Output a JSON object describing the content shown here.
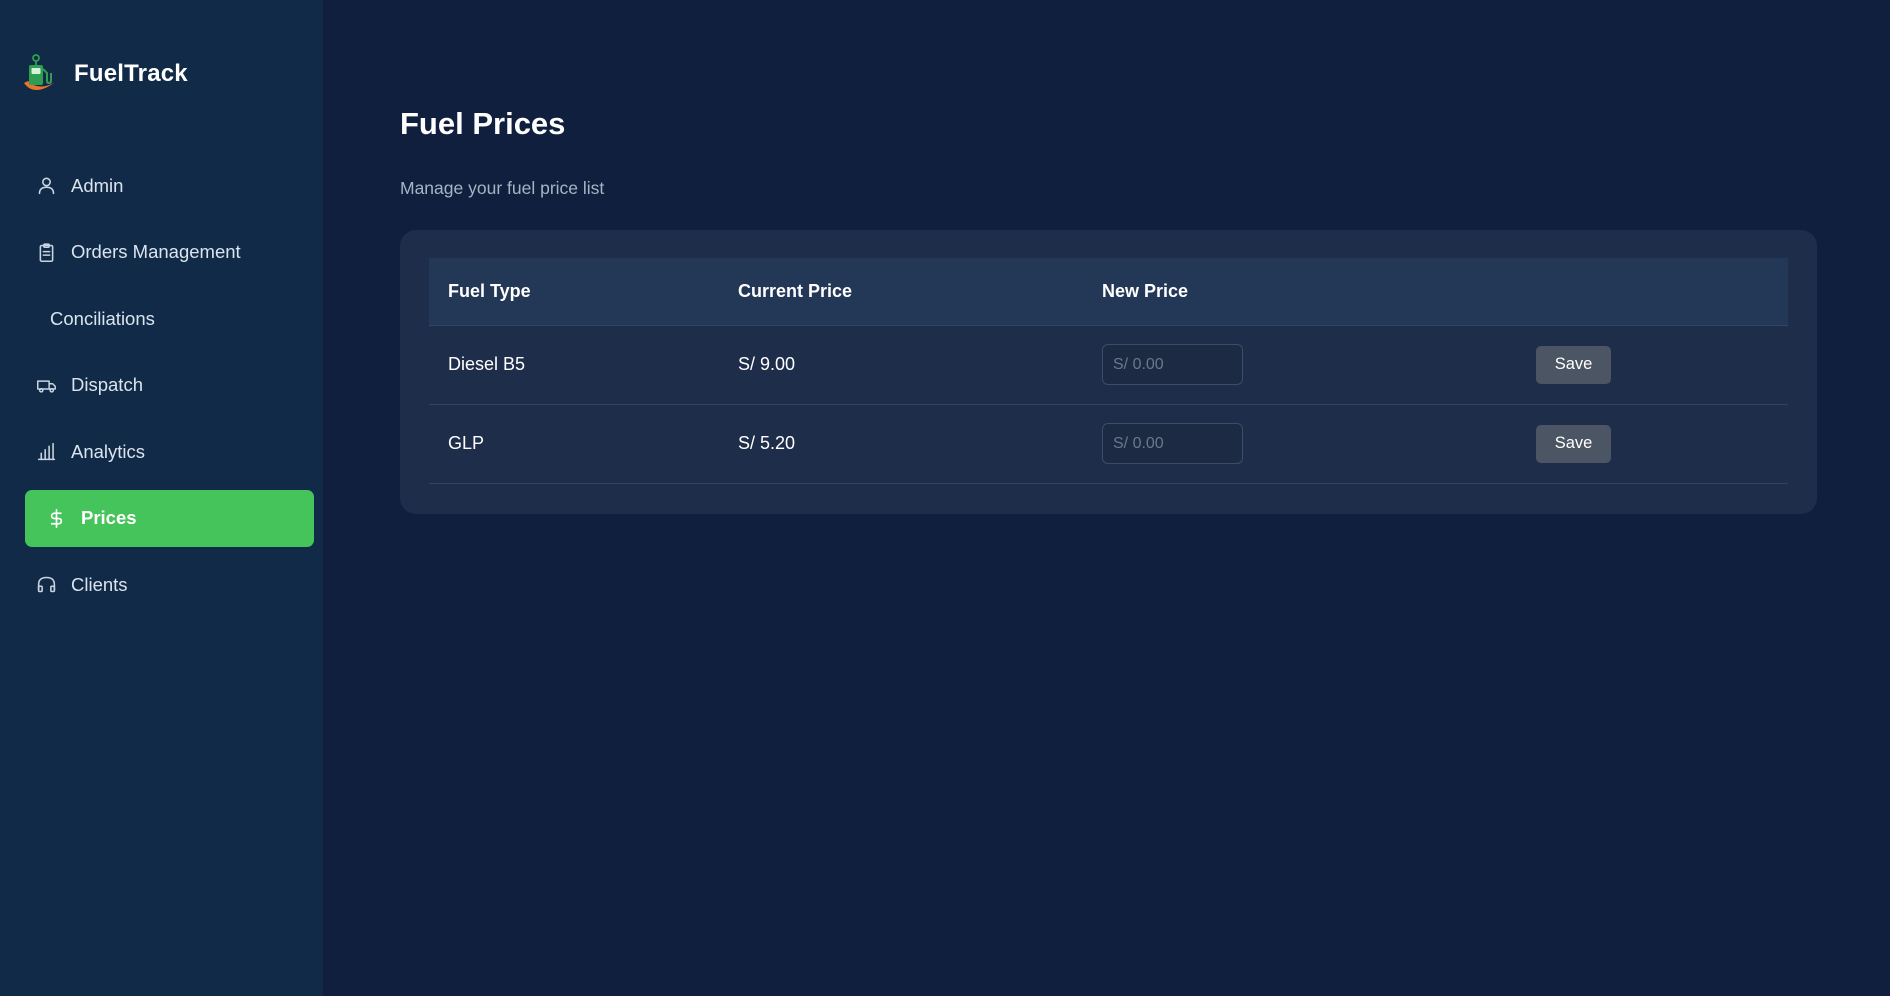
{
  "brand": {
    "name": "FuelTrack",
    "logo_icon": "fuel-pump-icon",
    "colors": {
      "pump": "#2e9e52",
      "swoosh": "#e8742a"
    }
  },
  "sidebar": {
    "items": [
      {
        "label": "Admin",
        "icon": "user-icon",
        "active": false
      },
      {
        "label": "Orders Management",
        "icon": "clipboard-icon",
        "active": false
      },
      {
        "label": "Conciliations",
        "icon": null,
        "active": false
      },
      {
        "label": "Dispatch",
        "icon": "truck-icon",
        "active": false
      },
      {
        "label": "Analytics",
        "icon": "bar-chart-icon",
        "active": false
      },
      {
        "label": "Prices",
        "icon": "dollar-icon",
        "active": true
      },
      {
        "label": "Clients",
        "icon": "headphones-icon",
        "active": false
      }
    ]
  },
  "page": {
    "title": "Fuel Prices",
    "subtitle": "Manage your fuel price list"
  },
  "table": {
    "headers": [
      "Fuel Type",
      "Current Price",
      "New Price",
      ""
    ],
    "rows": [
      {
        "fuel_type": "Diesel B5",
        "current_price": "S/ 9.00",
        "new_price_value": "",
        "new_price_placeholder": "S/ 0.00",
        "action_label": "Save"
      },
      {
        "fuel_type": "GLP",
        "current_price": "S/ 5.20",
        "new_price_value": "",
        "new_price_placeholder": "S/ 0.00",
        "action_label": "Save"
      }
    ]
  },
  "colors": {
    "accent": "#44c45a",
    "sidebar_bg": "#112a47",
    "main_bg": "#0f1f3d",
    "card_bg": "#1e2d4a",
    "button_bg": "#4c5563"
  }
}
